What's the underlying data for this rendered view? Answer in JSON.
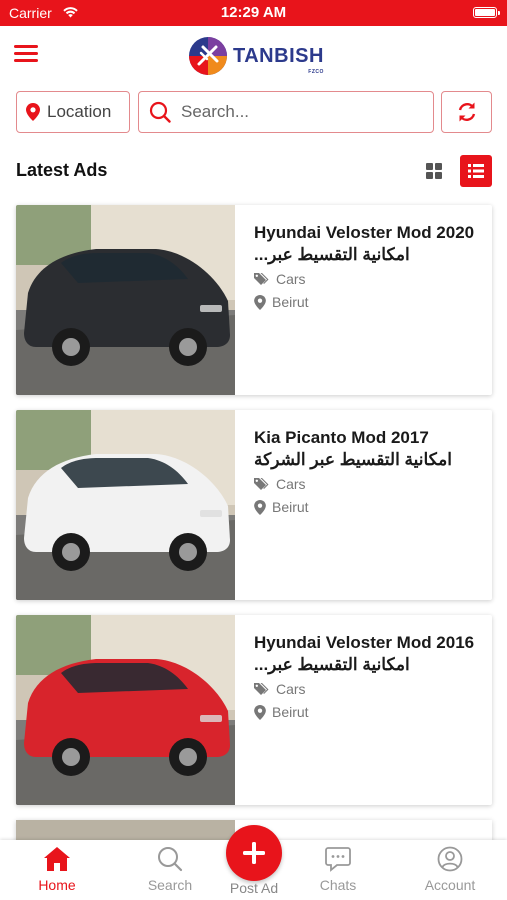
{
  "status_bar": {
    "carrier": "Carrier",
    "time": "12:29 AM"
  },
  "header": {
    "logo_text": "TANBISH",
    "logo_sub": "FZCO"
  },
  "search_row": {
    "location_label": "Location",
    "search_placeholder": "Search..."
  },
  "section": {
    "title": "Latest Ads",
    "view_mode": "list"
  },
  "ads": [
    {
      "title_line1": "Hyundai Veloster Mod 2020",
      "title_line2": "امكانية التقسيط عبر...",
      "category": "Cars",
      "location": "Beirut",
      "car_color": "#2b2d31"
    },
    {
      "title_line1": "Kia Picanto Mod 2017",
      "title_line2": "امكانية التقسيط عبر الشركة",
      "category": "Cars",
      "location": "Beirut",
      "car_color": "#f2f2f2"
    },
    {
      "title_line1": "Hyundai Veloster Mod 2016",
      "title_line2": "امكانية التقسيط عبر...",
      "category": "Cars",
      "location": "Beirut",
      "car_color": "#d8242c"
    }
  ],
  "tabs": [
    {
      "label": "Home",
      "icon": "home-icon",
      "active": true
    },
    {
      "label": "Search",
      "icon": "search-icon",
      "active": false
    },
    {
      "label": "Post Ad",
      "icon": "plus-icon",
      "active": false
    },
    {
      "label": "Chats",
      "icon": "chat-icon",
      "active": false
    },
    {
      "label": "Account",
      "icon": "account-icon",
      "active": false
    }
  ],
  "colors": {
    "accent": "#e8141b",
    "brand_blue": "#2c3a8c"
  }
}
